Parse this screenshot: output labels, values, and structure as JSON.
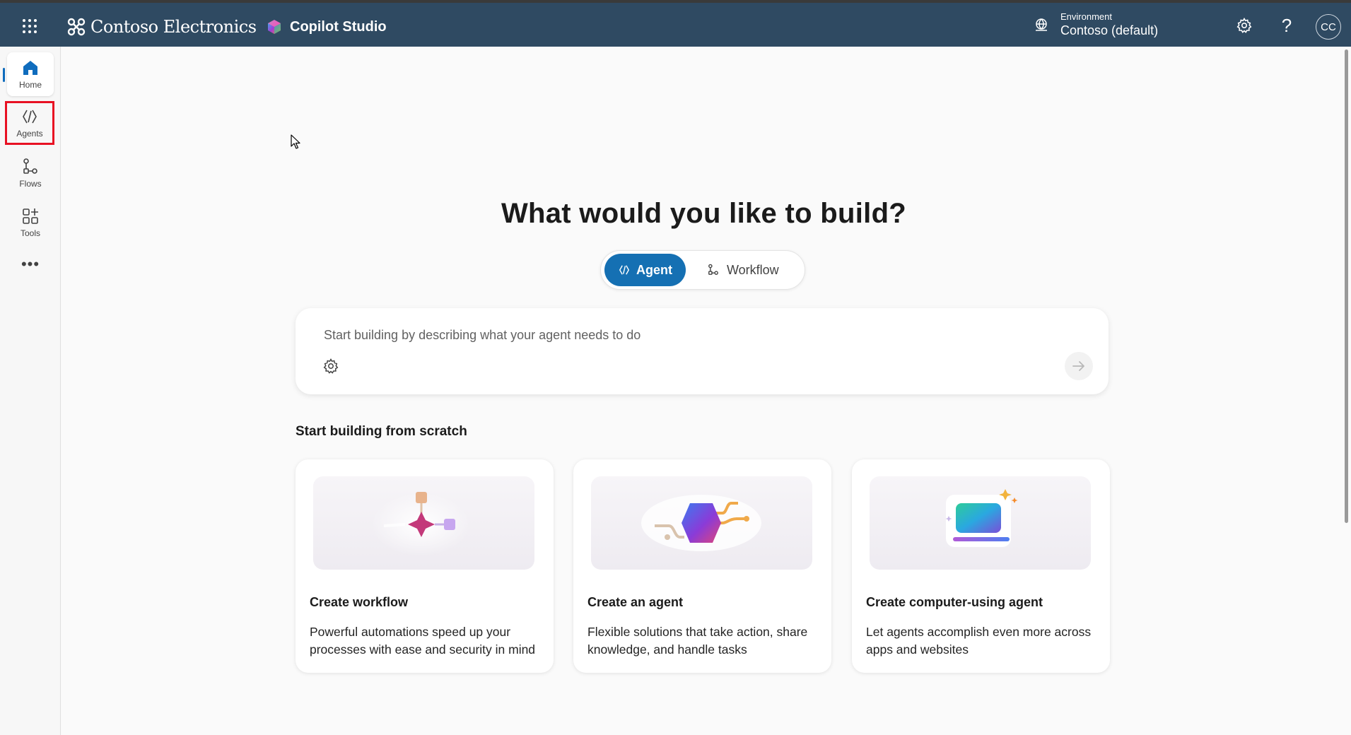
{
  "header": {
    "brand_name": "Contoso Electronics",
    "product_name": "Copilot Studio",
    "environment_label": "Environment",
    "environment_value": "Contoso (default)",
    "help_label": "?",
    "avatar_initials": "CC",
    "background_color": "#2f4a62"
  },
  "rail": {
    "items": [
      {
        "label": "Home",
        "icon": "home-icon",
        "selected": true
      },
      {
        "label": "Agents",
        "icon": "agents-icon",
        "highlighted": true
      },
      {
        "label": "Flows",
        "icon": "flows-icon"
      },
      {
        "label": "Tools",
        "icon": "tools-icon"
      }
    ],
    "more_label": "•••"
  },
  "main": {
    "title": "What would you like to build?",
    "toggle": {
      "agent_label": "Agent",
      "workflow_label": "Workflow",
      "selected": "Agent",
      "accent_color": "#1570b3"
    },
    "prompt": {
      "placeholder": "Start building by describing what your agent needs to do"
    },
    "section_title": "Start building from scratch",
    "cards": [
      {
        "title": "Create workflow",
        "description": "Powerful automations speed up your processes with ease and security in mind",
        "icon": "workflow-illustration"
      },
      {
        "title": "Create an agent",
        "description": "Flexible solutions that take action, share knowledge, and handle tasks",
        "icon": "agent-illustration"
      },
      {
        "title": "Create computer-using agent",
        "description": "Let agents accomplish even more across apps and websites",
        "icon": "computer-use-illustration"
      }
    ]
  }
}
